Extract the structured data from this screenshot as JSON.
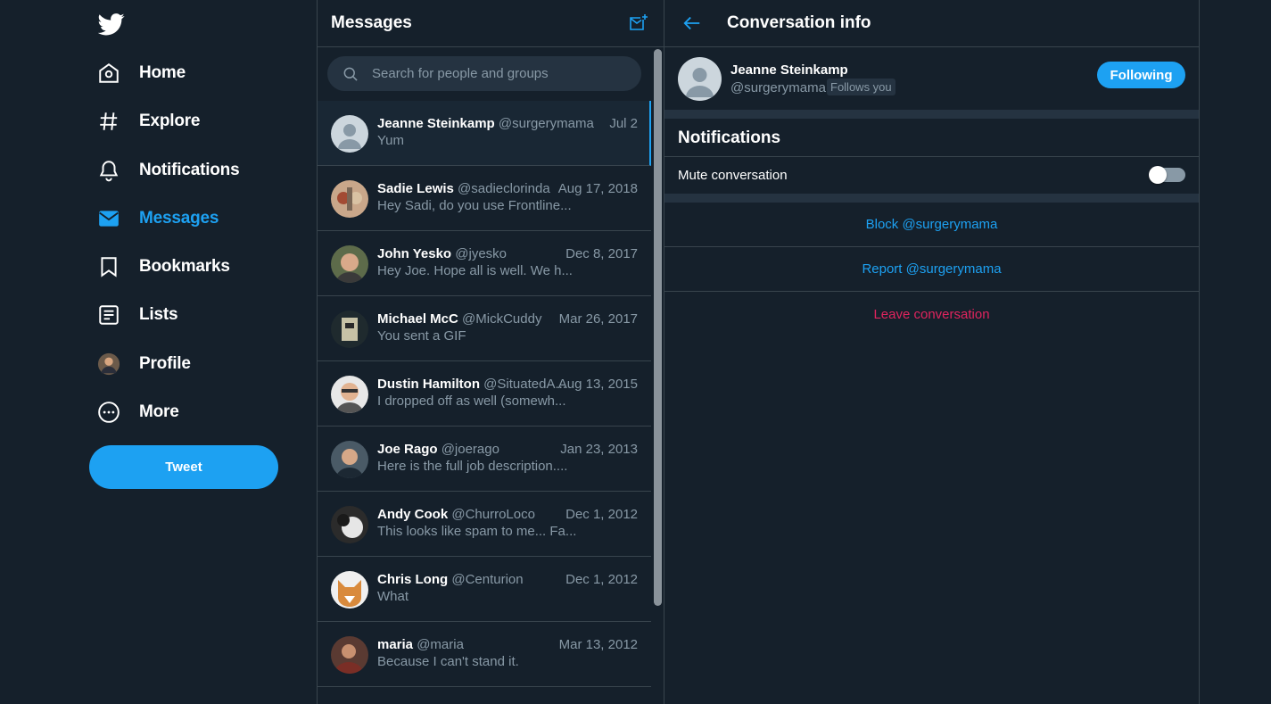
{
  "nav": {
    "items": [
      {
        "label": "Home",
        "icon": "home-icon"
      },
      {
        "label": "Explore",
        "icon": "hashtag-icon"
      },
      {
        "label": "Notifications",
        "icon": "bell-icon"
      },
      {
        "label": "Messages",
        "icon": "envelope-icon",
        "active": true
      },
      {
        "label": "Bookmarks",
        "icon": "bookmark-icon"
      },
      {
        "label": "Lists",
        "icon": "list-icon"
      },
      {
        "label": "Profile",
        "icon": "avatar"
      },
      {
        "label": "More",
        "icon": "more-icon"
      }
    ],
    "tweet_label": "Tweet"
  },
  "messages": {
    "title": "Messages",
    "search_placeholder": "Search for people and groups",
    "conversations": [
      {
        "name": "Jeanne Steinkamp",
        "handle": "@surgerymama",
        "date": "Jul 2",
        "preview": "Yum"
      },
      {
        "name": "Sadie Lewis",
        "handle": "@sadieclorinda",
        "date": "Aug 17, 2018",
        "preview": "Hey Sadi, do you use Frontline..."
      },
      {
        "name": "John Yesko",
        "handle": "@jyesko",
        "date": "Dec 8, 2017",
        "preview": "Hey Joe. Hope all is well. We h..."
      },
      {
        "name": "Michael McC",
        "handle": "@MickCuddy",
        "date": "Mar 26, 2017",
        "preview": "You sent a GIF"
      },
      {
        "name": "Dustin Hamilton",
        "handle": "@SituatedA...",
        "date": "Aug 13, 2015",
        "preview": "I dropped off as well (somewh..."
      },
      {
        "name": "Joe Rago",
        "handle": "@joerago",
        "date": "Jan 23, 2013",
        "preview": "Here is the full job description...."
      },
      {
        "name": "Andy Cook",
        "handle": "@ChurroLoco",
        "date": "Dec 1, 2012",
        "preview": "This looks like spam to me... Fa..."
      },
      {
        "name": "Chris Long",
        "handle": "@Centurion",
        "date": "Dec 1, 2012",
        "preview": "What"
      },
      {
        "name": "maria",
        "handle": "@maria",
        "date": "Mar 13, 2012",
        "preview": "Because I can't stand it."
      }
    ]
  },
  "info": {
    "title": "Conversation info",
    "user_name": "Jeanne Steinkamp",
    "user_handle": "@surgerymama",
    "follows_you": "Follows you",
    "following_label": "Following",
    "notifications_title": "Notifications",
    "mute_label": "Mute conversation",
    "mute_on": false,
    "block_label": "Block @surgerymama",
    "report_label": "Report @surgerymama",
    "leave_label": "Leave conversation"
  },
  "colors": {
    "background": "#15202b",
    "accent": "#1da1f2",
    "danger": "#e0245e",
    "muted": "#8899a6"
  }
}
